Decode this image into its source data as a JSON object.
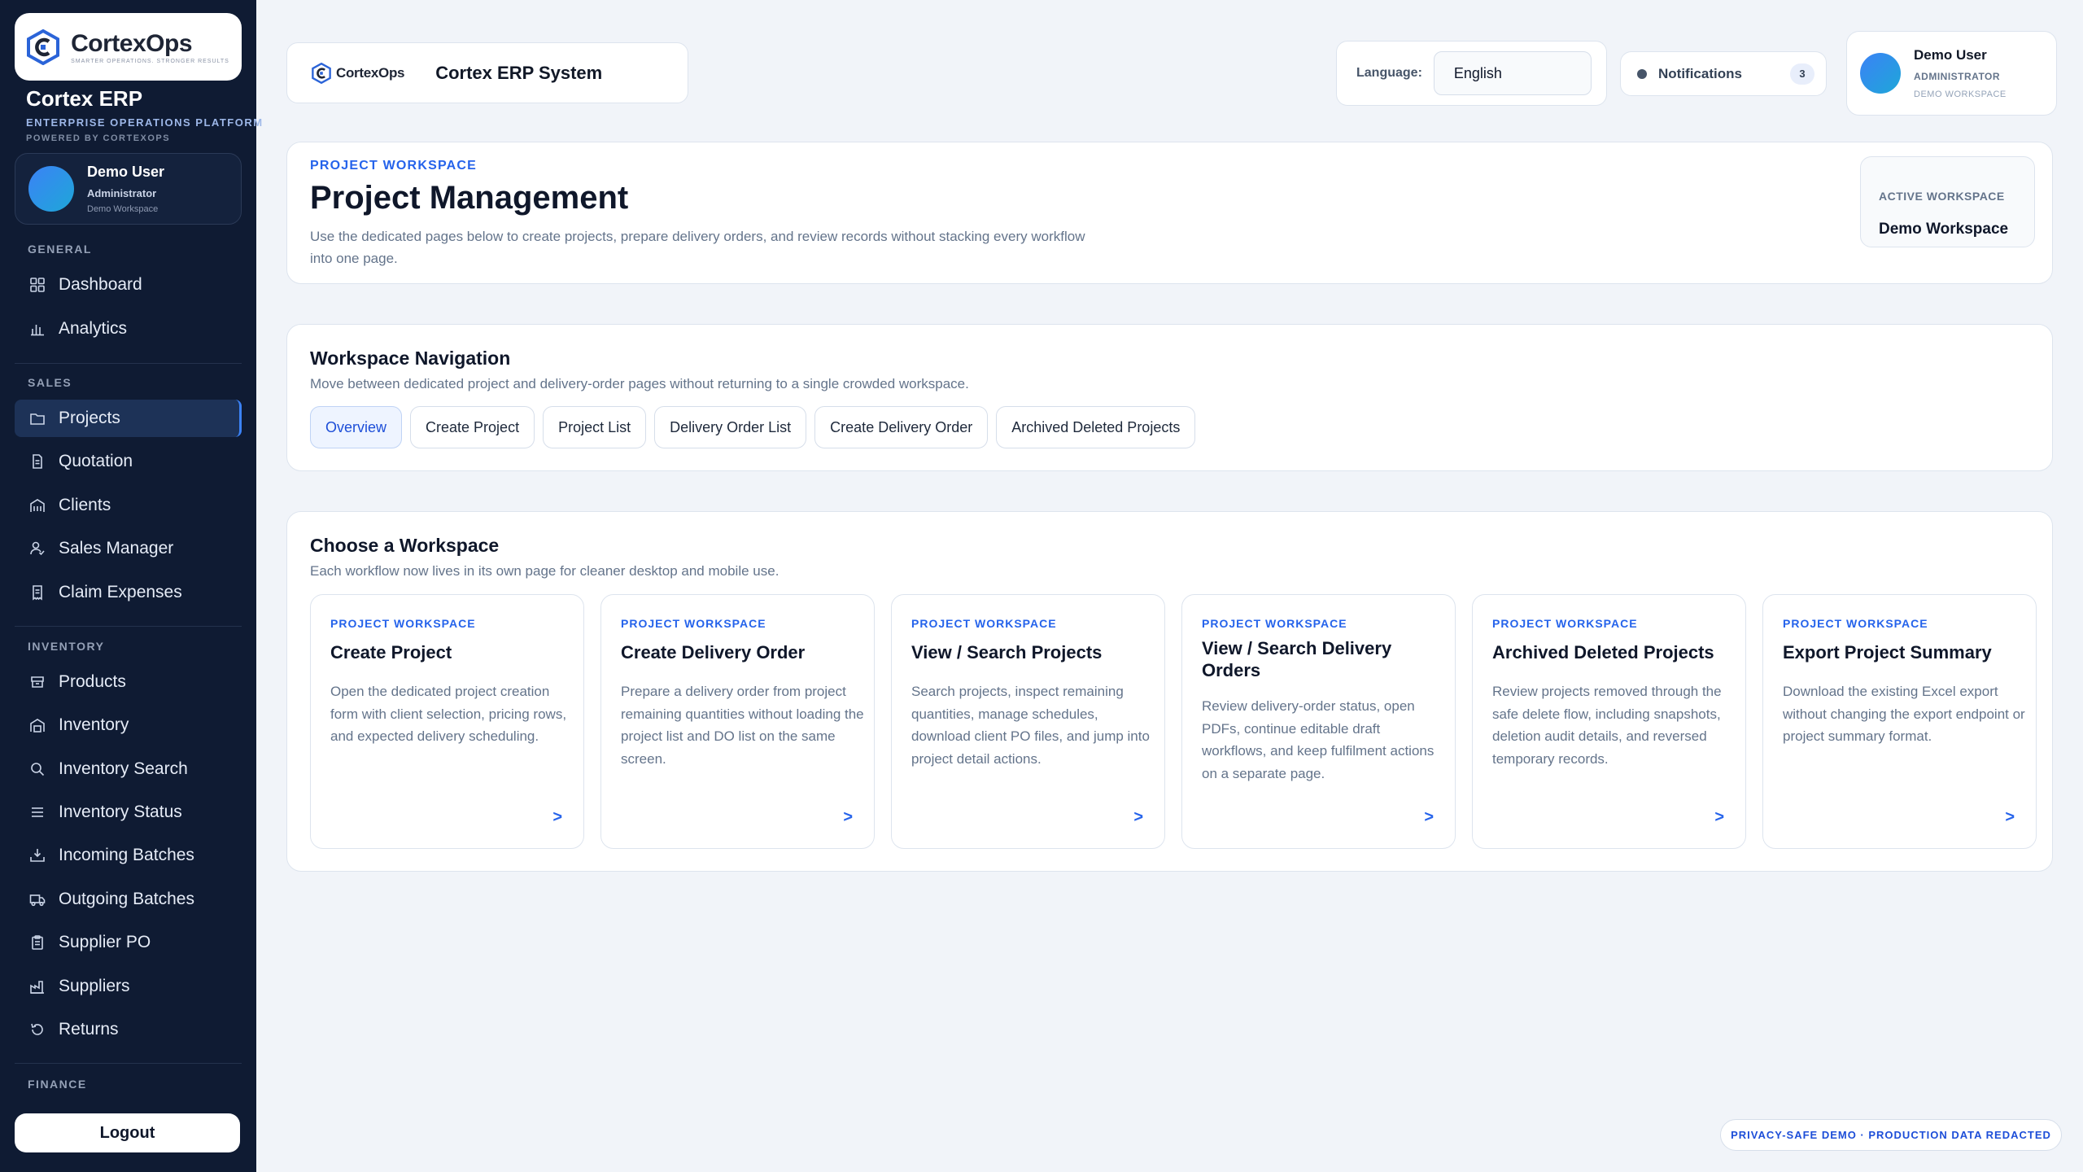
{
  "sidebar": {
    "logo_name": "CortexOps",
    "logo_tagline": "SMARTER OPERATIONS. STRONGER RESULTS",
    "brand_title": "Cortex ERP",
    "brand_subtitle": "ENTERPRISE OPERATIONS PLATFORM",
    "powered_by": "POWERED BY CORTEXOPS",
    "user": {
      "name": "Demo User",
      "role": "Administrator",
      "workspace": "Demo Workspace"
    },
    "sections": {
      "general": "GENERAL",
      "sales": "SALES",
      "inventory": "INVENTORY",
      "finance": "FINANCE"
    },
    "items": {
      "dashboard": "Dashboard",
      "analytics": "Analytics",
      "projects": "Projects",
      "quotation": "Quotation",
      "clients": "Clients",
      "sales_manager": "Sales Manager",
      "claim_expenses": "Claim Expenses",
      "products": "Products",
      "inventory": "Inventory",
      "inventory_search": "Inventory Search",
      "inventory_status": "Inventory Status",
      "incoming_batches": "Incoming Batches",
      "outgoing_batches": "Outgoing Batches",
      "supplier_po": "Supplier PO",
      "suppliers": "Suppliers",
      "returns": "Returns"
    },
    "active_item": "projects",
    "logout_label": "Logout"
  },
  "topbar": {
    "mini_logo_name": "CortexOps",
    "app_title": "Cortex ERP System",
    "language_label": "Language:",
    "language_value": "English",
    "notifications_label": "Notifications",
    "notifications_count": "3",
    "user": {
      "name": "Demo User",
      "role": "ADMINISTRATOR",
      "workspace": "DEMO WORKSPACE"
    }
  },
  "header": {
    "eyebrow": "PROJECT WORKSPACE",
    "title": "Project Management",
    "description": "Use the dedicated pages below to create projects, prepare delivery orders, and review records without stacking every workflow into one page.",
    "active_workspace_label": "ACTIVE WORKSPACE",
    "active_workspace_value": "Demo Workspace"
  },
  "workspace_nav": {
    "title": "Workspace Navigation",
    "description": "Move between dedicated project and delivery-order pages without returning to a single crowded workspace.",
    "tabs": [
      {
        "label": "Overview"
      },
      {
        "label": "Create Project"
      },
      {
        "label": "Project List"
      },
      {
        "label": "Delivery Order List"
      },
      {
        "label": "Create Delivery Order"
      },
      {
        "label": "Archived Deleted Projects"
      }
    ],
    "active_tab": 0
  },
  "choose_workspace": {
    "title": "Choose a Workspace",
    "description": "Each workflow now lives in its own page for cleaner desktop and mobile use.",
    "cards": [
      {
        "eyebrow": "PROJECT WORKSPACE",
        "title": "Create Project",
        "description": "Open the dedicated project creation form with client selection, pricing rows, and expected delivery scheduling.",
        "arrow": ">"
      },
      {
        "eyebrow": "PROJECT WORKSPACE",
        "title": "Create Delivery Order",
        "description": "Prepare a delivery order from project remaining quantities without loading the project list and DO list on the same screen.",
        "arrow": ">"
      },
      {
        "eyebrow": "PROJECT WORKSPACE",
        "title": "View / Search Projects",
        "description": "Search projects, inspect remaining quantities, manage schedules, download client PO files, and jump into project detail actions.",
        "arrow": ">"
      },
      {
        "eyebrow": "PROJECT WORKSPACE",
        "title": "View / Search Delivery Orders",
        "description": "Review delivery-order status, open PDFs, continue editable draft workflows, and keep fulfilment actions on a separate page.",
        "arrow": ">"
      },
      {
        "eyebrow": "PROJECT WORKSPACE",
        "title": "Archived Deleted Projects",
        "description": "Review projects removed through the safe delete flow, including snapshots, deletion audit details, and reversed temporary records.",
        "arrow": ">"
      },
      {
        "eyebrow": "PROJECT WORKSPACE",
        "title": "Export Project Summary",
        "description": "Download the existing Excel export without changing the export endpoint or project summary format.",
        "arrow": ">"
      }
    ]
  },
  "privacy_badge": "PRIVACY-SAFE DEMO · PRODUCTION DATA REDACTED",
  "colors": {
    "sidebar_bg": "#0f1b33",
    "accent": "#2563eb",
    "page_bg": "#f1f4f9",
    "active_nav": "#1d3257"
  }
}
